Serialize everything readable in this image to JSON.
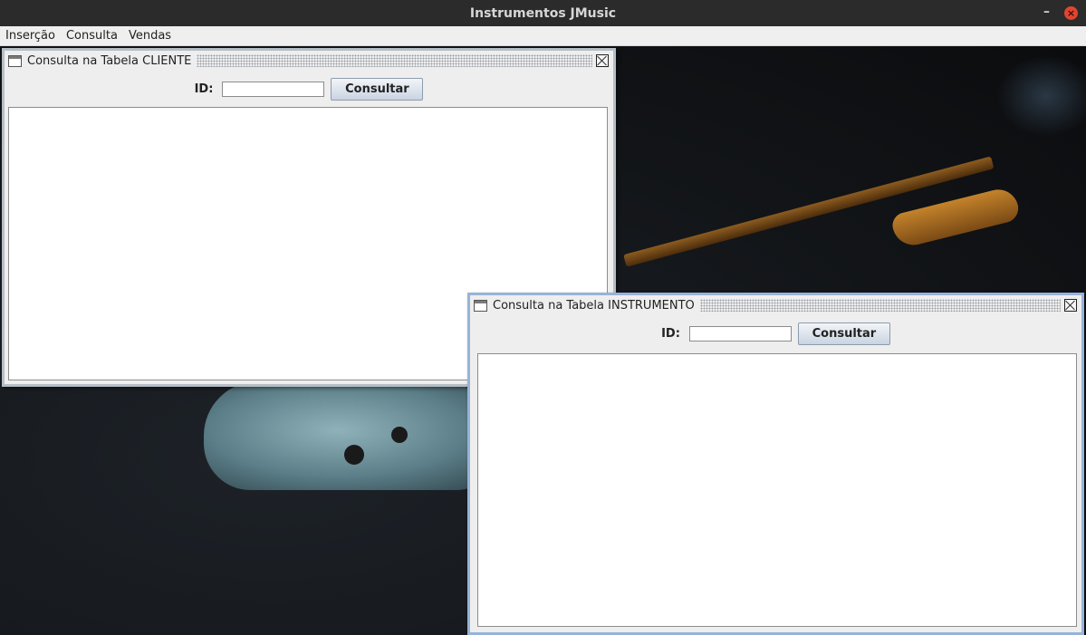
{
  "app": {
    "title": "Instrumentos JMusic",
    "minimize_glyph": "–",
    "close_glyph": "×"
  },
  "menu": {
    "items": [
      "Inserção",
      "Consulta",
      "Vendas"
    ]
  },
  "frames": {
    "cliente": {
      "title": "Consulta na Tabela CLIENTE",
      "id_label": "ID:",
      "id_value": "",
      "button_label": "Consultar",
      "result_text": ""
    },
    "instrumento": {
      "title": "Consulta na Tabela INSTRUMENTO",
      "id_label": "ID:",
      "id_value": "",
      "button_label": "Consultar",
      "result_text": ""
    }
  },
  "colors": {
    "titlebar": "#2b2b2b",
    "menubar": "#efefef",
    "frame_active_border": "#97b3d8",
    "frame_inactive_border": "#b6bec5",
    "close_button": "#e0452f"
  }
}
